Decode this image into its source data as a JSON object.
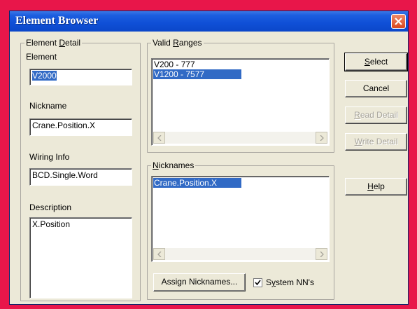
{
  "window": {
    "title": "Element Browser"
  },
  "element_detail": {
    "legend_pre": "Element ",
    "legend_key": "D",
    "legend_post": "etail",
    "element_label": "Element",
    "element_value": "V2000",
    "nickname_label": "Nickname",
    "nickname_value": "Crane.Position.X",
    "wiring_label": "Wiring Info",
    "wiring_value": "BCD.Single.Word",
    "description_label": "Description",
    "description_value": "X.Position"
  },
  "valid_ranges": {
    "legend_pre": "Valid ",
    "legend_key": "R",
    "legend_post": "anges",
    "items": [
      "V200 - 777",
      "V1200 - 7577"
    ]
  },
  "nicknames": {
    "legend_pre": "",
    "legend_key": "N",
    "legend_post": "icknames",
    "items": [
      "Crane.Position.X"
    ]
  },
  "buttons": {
    "select_key": "S",
    "select_rest": "elect",
    "cancel": "Cancel",
    "read_key": "R",
    "read_rest": "ead Detail",
    "write_key": "W",
    "write_rest": "rite Detail",
    "help_key": "H",
    "help_rest": "elp",
    "assign_nicknames": "Assign Nicknames..."
  },
  "system_nn": {
    "label_pre": "S",
    "label_key": "y",
    "label_post": "stem NN's",
    "checked": true
  }
}
